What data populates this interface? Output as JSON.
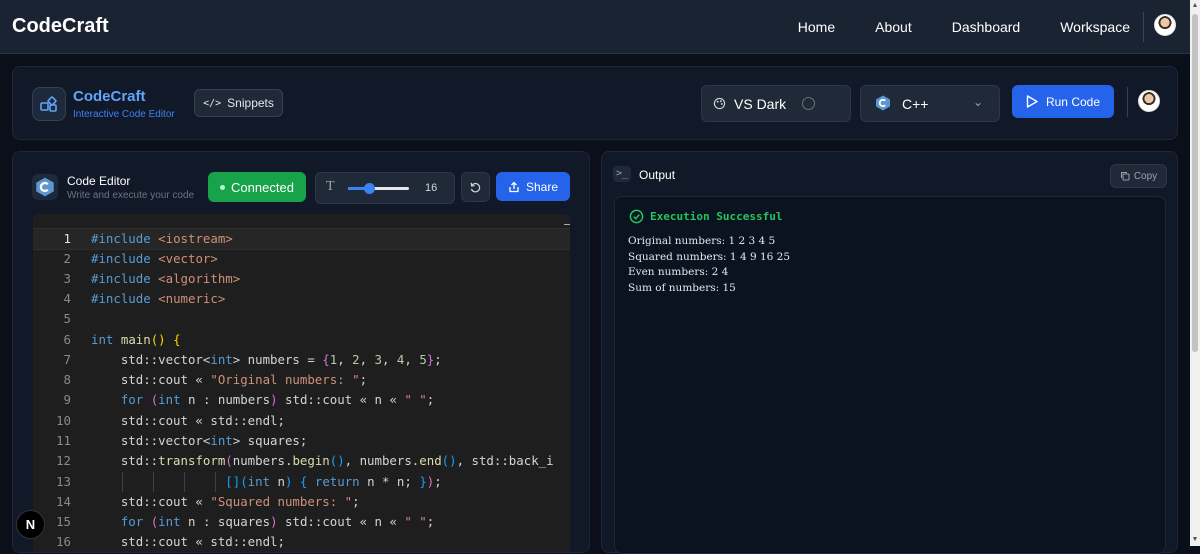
{
  "nav": {
    "brand": "CodeCraft",
    "links": [
      "Home",
      "About",
      "Dashboard",
      "Workspace"
    ]
  },
  "toolbar": {
    "title": "CodeCraft",
    "subtitle": "Interactive Code Editor",
    "snippets_label": "Snippets",
    "theme_label": "VS Dark",
    "language_label": "C++",
    "run_label": "Run Code"
  },
  "editor": {
    "title": "Code Editor",
    "subtitle": "Write and execute your code",
    "status_label": "Connected",
    "font_size": "16",
    "font_size_fraction": 0.35,
    "share_label": "Share",
    "lines": [
      {
        "n": "1"
      },
      {
        "n": "2"
      },
      {
        "n": "3"
      },
      {
        "n": "4"
      },
      {
        "n": "5"
      },
      {
        "n": "6"
      },
      {
        "n": "7"
      },
      {
        "n": "8"
      },
      {
        "n": "9"
      },
      {
        "n": "10"
      },
      {
        "n": "11"
      },
      {
        "n": "12"
      },
      {
        "n": "13"
      },
      {
        "n": "14"
      },
      {
        "n": "15"
      },
      {
        "n": "16"
      }
    ]
  },
  "output": {
    "title": "Output",
    "copy_label": "Copy",
    "status": "Execution Successful",
    "lines": [
      "Original numbers: 1 2 3 4 5",
      "Squared numbers: 1 4 9 16 25",
      "Even numbers: 2 4",
      "Sum of numbers: 15"
    ]
  },
  "colors": {
    "accent": "#2563eb",
    "connected": "#16a34a",
    "success": "#22c55e"
  },
  "icons": {
    "logo": "grid-icon",
    "snippets": "code-icon",
    "theme": "palette-icon",
    "language": "cpp-logo-icon",
    "run": "play-icon",
    "reset": "refresh-icon",
    "share": "share-icon",
    "terminal": "terminal-icon",
    "copy": "copy-icon",
    "check": "check-circle-icon",
    "nextjs": "nextjs-icon"
  }
}
